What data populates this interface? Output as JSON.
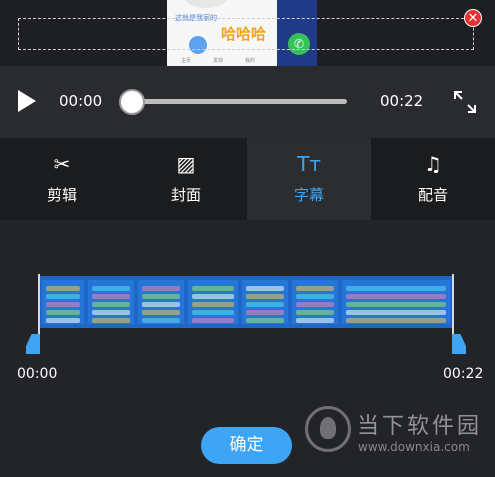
{
  "preview": {
    "small_text": "这就是我家的",
    "caption": "哈哈哈",
    "nav_items": [
      "",
      "主页",
      "发现",
      "我的"
    ],
    "close_label": "✕"
  },
  "player": {
    "current_time": "00:00",
    "total_time": "00:22",
    "progress": 0
  },
  "tabs": [
    {
      "icon": "scissors-icon",
      "glyph": "✂",
      "label": "剪辑",
      "active": false
    },
    {
      "icon": "image-icon",
      "glyph": "▨",
      "label": "封面",
      "active": false
    },
    {
      "icon": "text-size-icon",
      "glyph": "Tт",
      "label": "字幕",
      "active": true
    },
    {
      "icon": "music-note-icon",
      "glyph": "♫",
      "label": "配音",
      "active": false
    }
  ],
  "timeline": {
    "start": "00:00",
    "end": "00:22"
  },
  "confirm_label": "确定",
  "watermark": {
    "name": "当下软件园",
    "url": "www.downxia.com"
  },
  "colors": {
    "accent": "#3ea4f4",
    "caption": "#f2a31b",
    "background": "#232427"
  }
}
